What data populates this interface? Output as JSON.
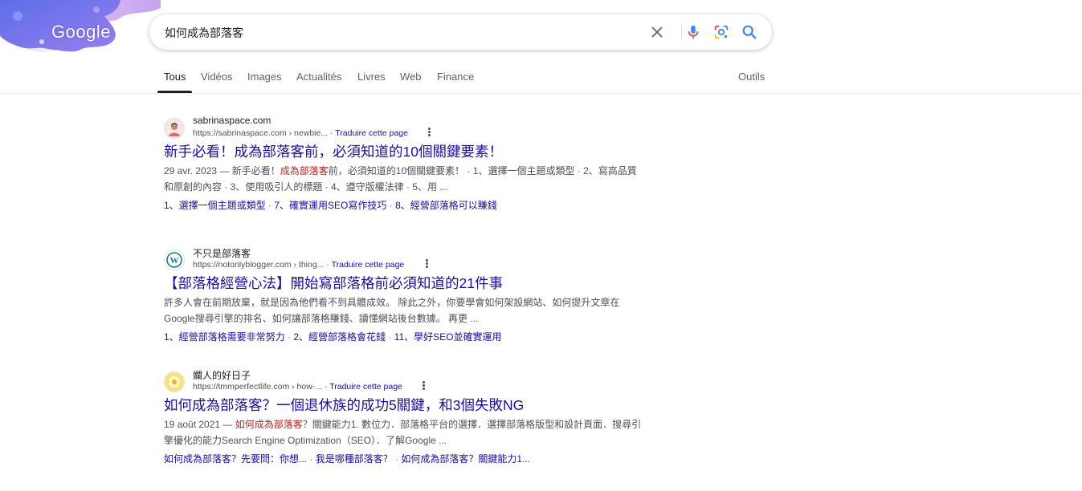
{
  "logo": {
    "text": "Google"
  },
  "search": {
    "query": "如何成為部落客"
  },
  "tabs": [
    {
      "label": "Tous",
      "active": true
    },
    {
      "label": "Vidéos"
    },
    {
      "label": "Images"
    },
    {
      "label": "Actualités"
    },
    {
      "label": "Livres"
    },
    {
      "label": "Web"
    },
    {
      "label": "Finance"
    }
  ],
  "tools_label": "Outils",
  "results": [
    {
      "site_name": "sabrinaspace.com",
      "url": "https://sabrinaspace.com › newbie...",
      "translate": "Traduire cette page",
      "title": "新手必看！成為部落客前，必須知道的10個關鍵要素！",
      "date": "29 avr. 2023",
      "snippet_pre": "新手必看！",
      "snippet_hl": "成為部落客",
      "snippet_post": "前，必須知道的10個關鍵要素！ · 1、選擇一個主題或類型 · 2、寫高品質和原創的內容 · 3、使用吸引人的標題 · 4、遵守版權法律 · 5、用 ...",
      "sitelinks": [
        "1、選擇一個主題或類型",
        "7、確實運用SEO寫作技巧",
        "8、經營部落格可以賺錢"
      ]
    },
    {
      "site_name": "不只是部落客",
      "url": "https://notonlyblogger.com › thing...",
      "translate": "Traduire cette page",
      "title": "【部落格經營心法】開始寫部落格前必須知道的21件事",
      "snippet": "許多人會在前期放棄，就是因為他們看不到具體成效。 除此之外，你要學會如何架設網站、如何提升文章在Google搜尋引擎的排名、如何讓部落格賺錢、讀懂網站後台數據。 再更 ...",
      "sitelinks": [
        "1、經營部落格需要非常努力",
        "2、經營部落格會花錢",
        "11、學好SEO並確實運用"
      ]
    },
    {
      "site_name": "孄人的好日子",
      "url": "https://tmmperfectlife.com › how-...",
      "translate": "Traduire cette page",
      "title": "如何成為部落客？一個退休族的成功5關鍵，和3個失敗NG",
      "date": "19 août 2021",
      "snippet_hl": "如何成為部落客",
      "snippet_post": "？關鍵能力1. 數位力．部落格平台的選擇．選擇部落格版型和設計頁面．搜尋引擎優化的能力Search Engine Optimization（SEO）．了解Google ...",
      "sitelinks": [
        "如何成為部落客？先要問：你想...",
        "我是哪種部落客？",
        "如何成為部落客？關鍵能力1..."
      ]
    }
  ]
}
